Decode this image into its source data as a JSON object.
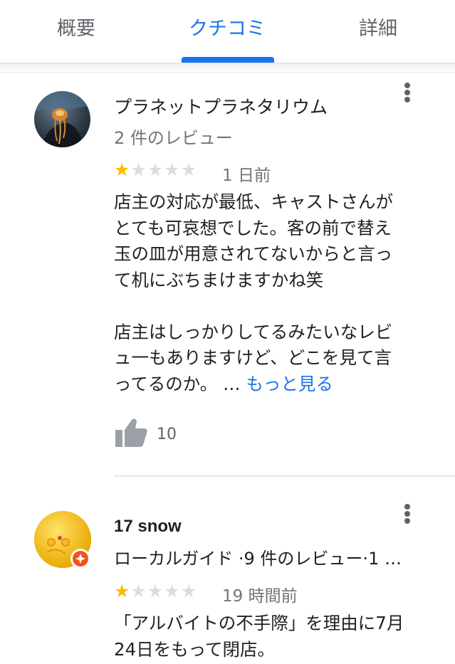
{
  "tabs": [
    {
      "label": "概要",
      "active": false
    },
    {
      "label": "クチコミ",
      "active": true
    },
    {
      "label": "詳細",
      "active": false
    }
  ],
  "colors": {
    "accent": "#1a73e8",
    "star": "#fbbc04",
    "star_off": "#dadce0"
  },
  "reviews": [
    {
      "name": "プラネットプラネタリウム",
      "meta": "2 件のレビュー",
      "rating": 1,
      "rating_max": 5,
      "date": "1 日前",
      "text": "店主の対応が最低、キャストさんが\nとても可哀想でした。客の前で替え\n玉の皿が用意されてないからと言っ\nて机にぶちまけますかね笑\n\n店主はしっかりしてるみたいなレビ\nュ一もありますけど、どこを見て言\nってるのか。",
      "ellipsis": "…",
      "more_label": "もっと見る",
      "likes": "10"
    },
    {
      "name": "17 snow",
      "meta": "ローカルガイド ·9 件のレビュー·1 …",
      "rating": 1,
      "rating_max": 5,
      "date": "19 時間前",
      "text": "「アルバイトの不手際」を理由に7月\n24日をもって閉店。"
    }
  ],
  "icons": {
    "more": "more-vert-icon",
    "like": "thumb-up-icon",
    "badge": "local-guide-badge-icon"
  }
}
